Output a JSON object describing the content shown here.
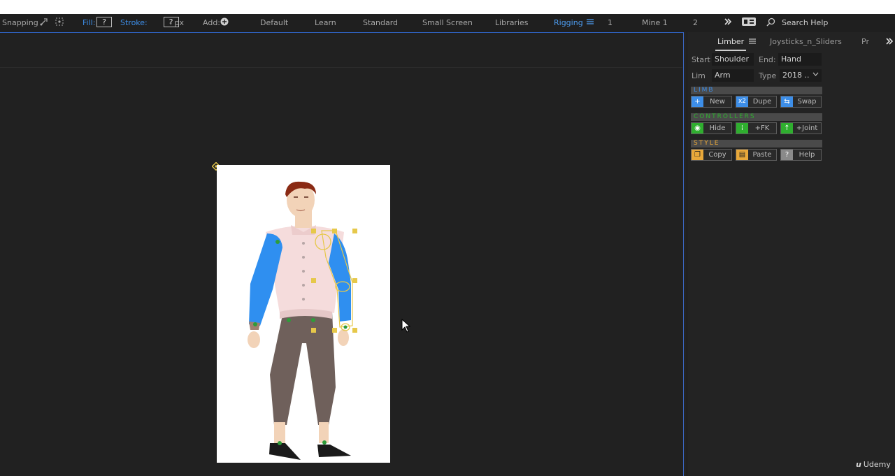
{
  "toolbar": {
    "snapping": "Snapping",
    "fill_label": "Fill:",
    "fill_value": "?",
    "stroke_label": "Stroke:",
    "stroke_value": "?",
    "stroke_px": "- px",
    "add_label": "Add:",
    "workspaces": [
      "Default",
      "Learn",
      "Standard",
      "Small Screen",
      "Libraries",
      "Rigging",
      "1",
      "Mine 1",
      "2"
    ],
    "active_workspace": "Rigging",
    "search_help": "Search Help"
  },
  "panel": {
    "tabs": [
      "Limber",
      "Joysticks_n_Sliders",
      "Pr"
    ],
    "active_tab": "Limber",
    "start_label": "Start",
    "start_value": "Shoulder",
    "end_label": "End:",
    "end_value": "Hand",
    "lim_label": "Lim",
    "lim_value": "Arm",
    "type_label": "Type",
    "type_value": "2018 ..",
    "sections": {
      "limb": {
        "title": "LIMB",
        "color": "#3d8ee8",
        "buttons": [
          {
            "icon": "+",
            "label": "New",
            "color": "#3d8ee8"
          },
          {
            "icon": "x2",
            "label": "Dupe",
            "color": "#3d8ee8"
          },
          {
            "icon": "⇆",
            "label": "Swap",
            "color": "#3d8ee8"
          }
        ]
      },
      "controllers": {
        "title": "CONTROLLERS",
        "color": "#2fae2f",
        "buttons": [
          {
            "icon": "◉",
            "label": "Hide",
            "color": "#2fae2f"
          },
          {
            "icon": "⁞",
            "label": "+FK",
            "color": "#2fae2f"
          },
          {
            "icon": "↑",
            "label": "+Joint",
            "color": "#2fae2f"
          }
        ]
      },
      "style": {
        "title": "STYLE",
        "color": "#e8a83a",
        "buttons": [
          {
            "icon": "❐",
            "label": "Copy",
            "color": "#e8a83a"
          },
          {
            "icon": "▤",
            "label": "Paste",
            "color": "#e8a83a"
          },
          {
            "icon": "?",
            "label": "Help",
            "color": "#8a8a8a"
          }
        ]
      }
    }
  },
  "watermark": "Udemy",
  "colors": {
    "accent": "#3d8ee8",
    "rig_yellow": "#e6c84a",
    "arm_blue": "#2f8ff0",
    "joint_green": "#2e9c3a"
  }
}
